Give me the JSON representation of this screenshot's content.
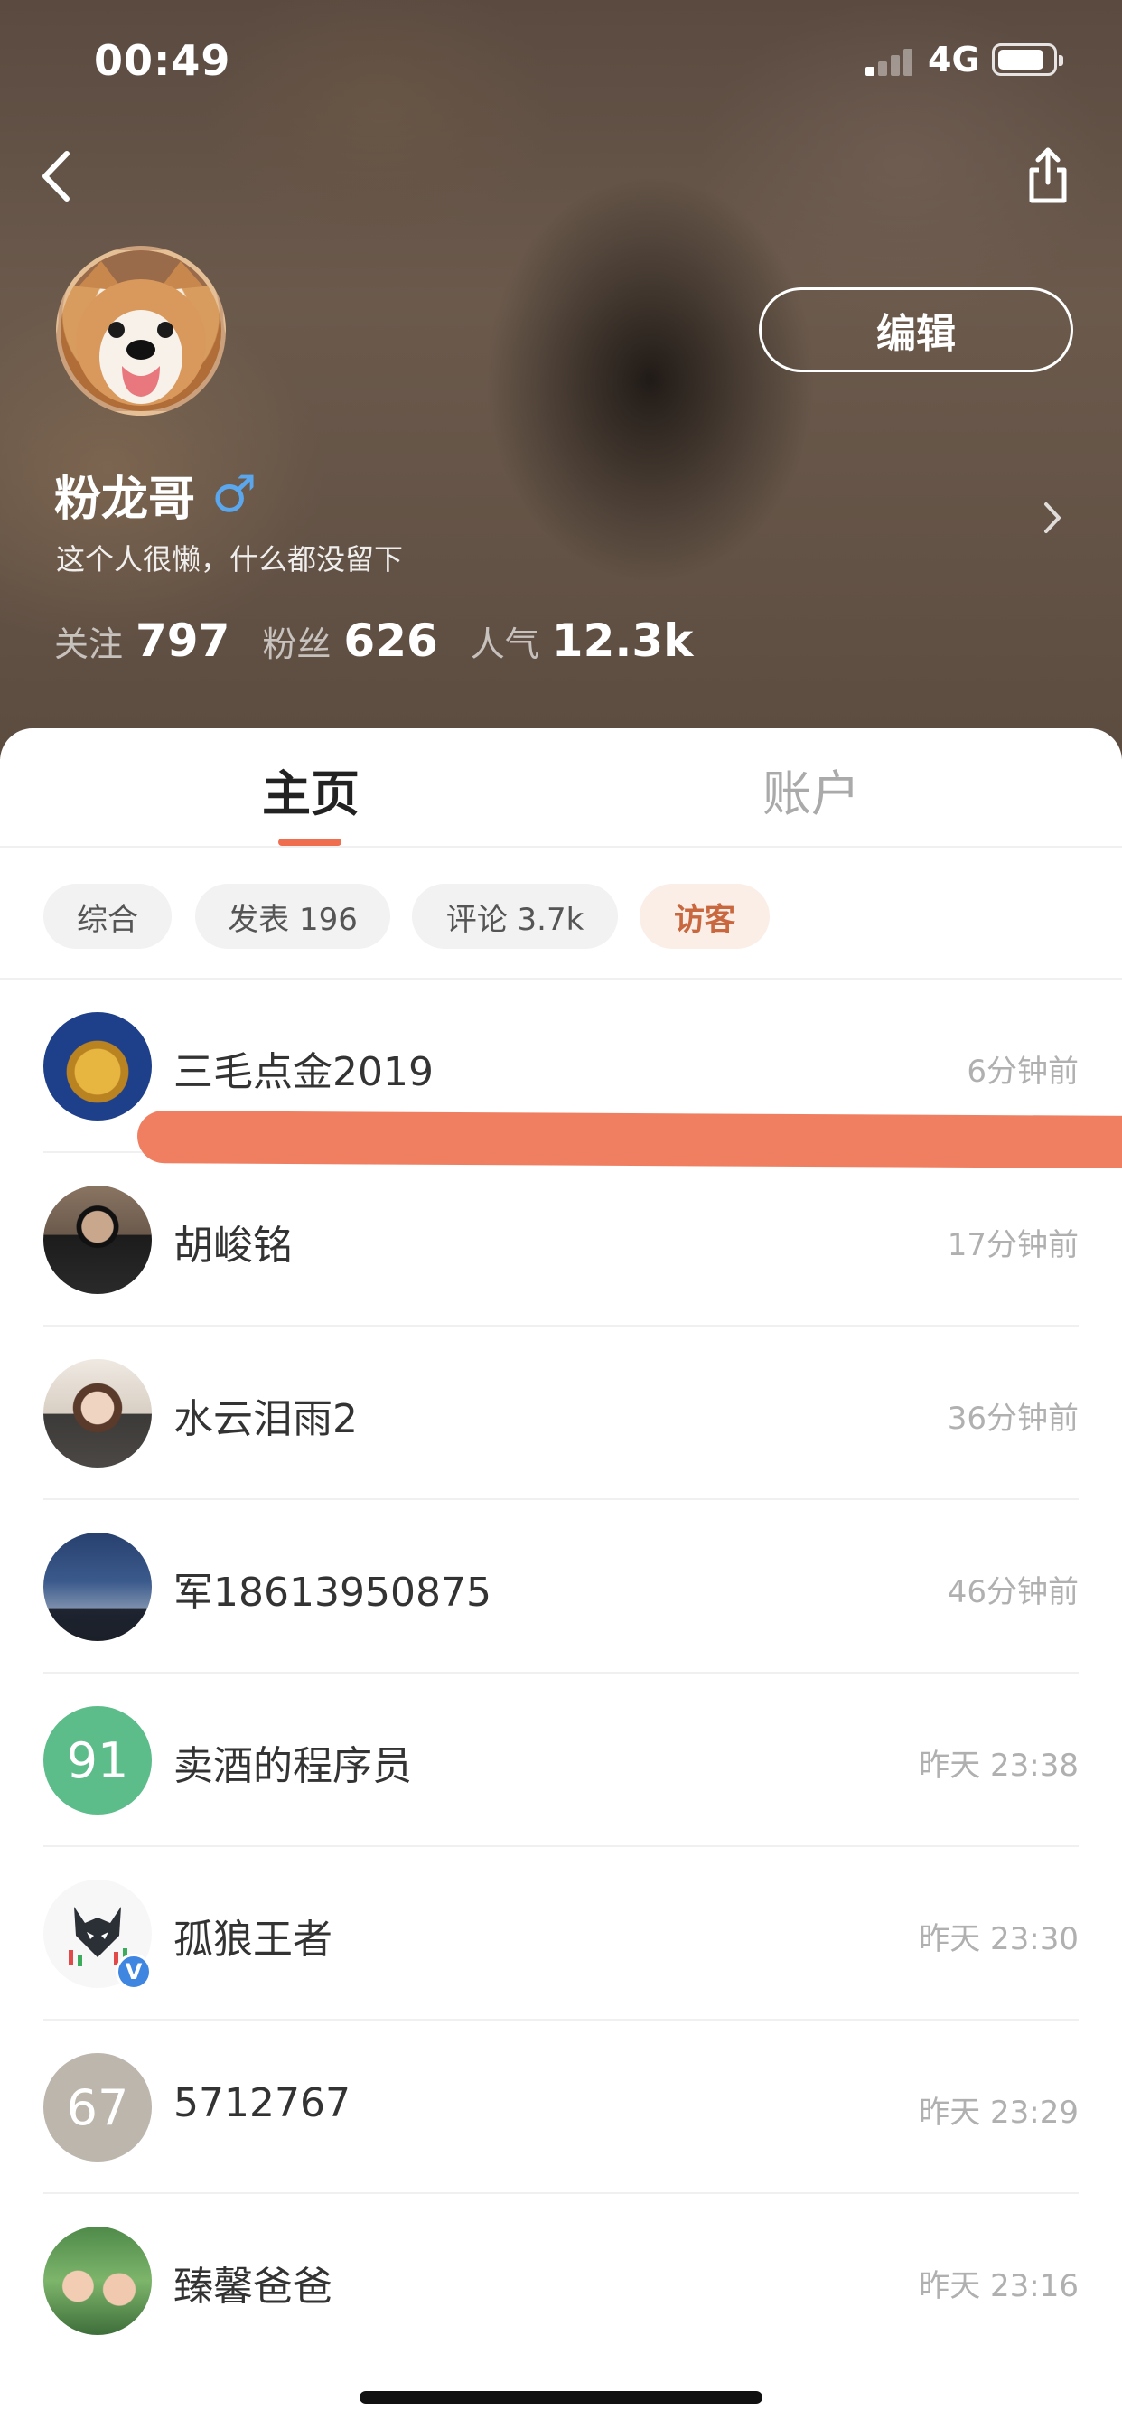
{
  "status_bar": {
    "time": "00:49",
    "network": "4G"
  },
  "header": {
    "edit_label": "编辑",
    "username": "粉龙哥",
    "gender_symbol": "♂",
    "bio": "这个人很懒，什么都没留下",
    "stats": [
      {
        "label": "关注",
        "value": "797"
      },
      {
        "label": "粉丝",
        "value": "626"
      },
      {
        "label": "人气",
        "value": "12.3k"
      }
    ],
    "icons": {
      "back": "chevron-left-icon",
      "share": "share-icon",
      "profile_more": "chevron-right-icon"
    }
  },
  "tabs": [
    {
      "label": "主页",
      "active": true
    },
    {
      "label": "账户",
      "active": false
    }
  ],
  "filters": [
    {
      "label": "综合",
      "active": false
    },
    {
      "label": "发表 196",
      "active": false
    },
    {
      "label": "评论 3.7k",
      "active": false
    },
    {
      "label": "访客",
      "active": true
    }
  ],
  "visitors": [
    {
      "name": "三毛点金2019",
      "time": "6分钟前",
      "avatar": "photo"
    },
    {
      "name": "胡峻铭",
      "time": "17分钟前",
      "avatar": "photo"
    },
    {
      "name": "水云泪雨2",
      "time": "36分钟前",
      "avatar": "photo"
    },
    {
      "name": "军18613950875",
      "time": "46分钟前",
      "avatar": "photo"
    },
    {
      "name": "卖酒的程序员",
      "time": "昨天 23:38",
      "avatar_text": "91",
      "avatar_color": "#5cbd8a"
    },
    {
      "name": "孤狼王者",
      "time": "昨天 23:30",
      "avatar": "photo",
      "verified_mark": "V"
    },
    {
      "name": "5712767",
      "time": "昨天 23:29",
      "avatar_text": "67",
      "avatar_color": "#bcb6ac"
    },
    {
      "name": "臻馨爸爸",
      "time": "昨天 23:16",
      "avatar": "photo"
    }
  ],
  "colors": {
    "accent": "#ef6e4f",
    "active_chip_bg": "#fbeee7",
    "active_chip_text": "#c9673f"
  }
}
